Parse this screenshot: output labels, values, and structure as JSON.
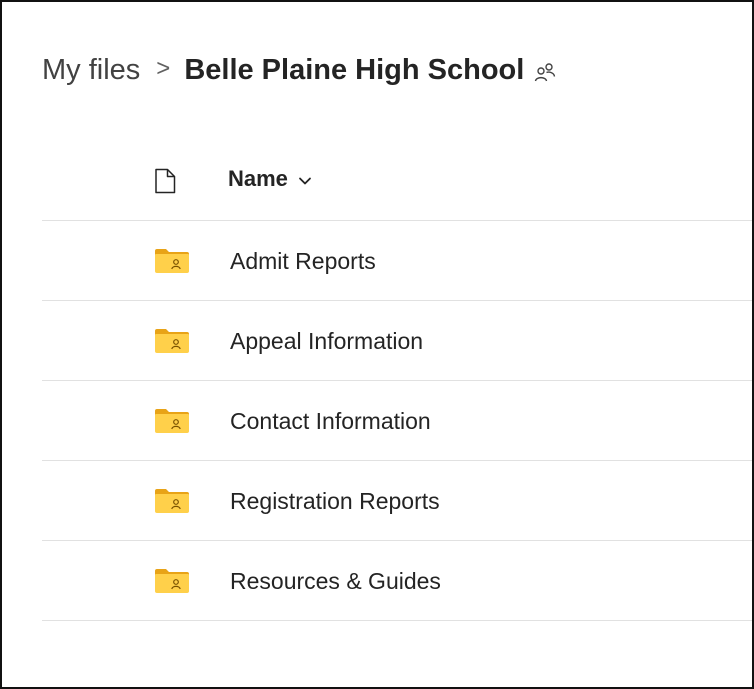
{
  "breadcrumb": {
    "root": "My files",
    "separator": ">",
    "current": "Belle Plaine High School",
    "shared_icon": "shared-people-icon"
  },
  "list": {
    "header": {
      "file_type_icon": "document-icon",
      "name_label": "Name",
      "sort_icon": "chevron-down-icon"
    },
    "items": [
      {
        "name": "Admit Reports",
        "icon": "shared-folder-icon"
      },
      {
        "name": "Appeal Information",
        "icon": "shared-folder-icon"
      },
      {
        "name": "Contact Information",
        "icon": "shared-folder-icon"
      },
      {
        "name": "Registration Reports",
        "icon": "shared-folder-icon"
      },
      {
        "name": "Resources & Guides",
        "icon": "shared-folder-icon"
      }
    ]
  },
  "colors": {
    "folder_back": "#e8a317",
    "folder_front": "#ffd04a",
    "border": "#111111",
    "divider": "#e1e1e1",
    "text": "#242424"
  }
}
